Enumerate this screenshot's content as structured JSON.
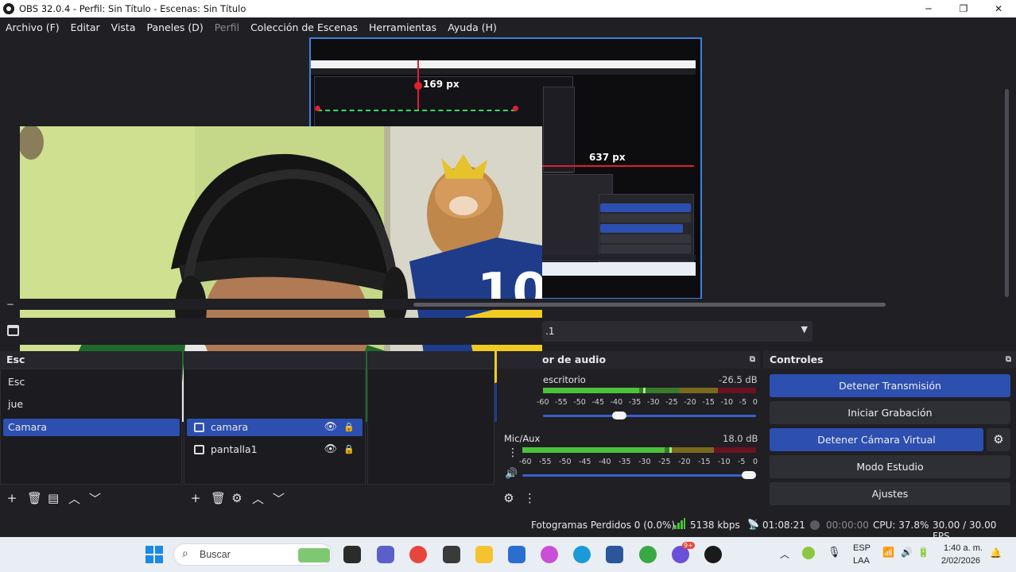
{
  "window": {
    "title": "OBS 32.0.4 - Perfil: Sin Título - Escenas: Sin Título",
    "minimize_glyph": "─",
    "maximize_glyph": "❐",
    "close_glyph": "✕"
  },
  "menu": [
    {
      "label": "Archivo (F)",
      "enabled": true
    },
    {
      "label": "Editar",
      "enabled": true
    },
    {
      "label": "Vista",
      "enabled": true
    },
    {
      "label": "Paneles (D)",
      "enabled": true
    },
    {
      "label": "Perfil",
      "enabled": false
    },
    {
      "label": "Colección de Escenas",
      "enabled": true
    },
    {
      "label": "Herramientas",
      "enabled": true
    },
    {
      "label": "Ayuda (H)",
      "enabled": true
    }
  ],
  "preview": {
    "label_top": "169 px",
    "label_right": "637 px"
  },
  "scene_bar": {
    "combo_value": ".1"
  },
  "scenes_dock": {
    "title": "Esc",
    "items": [
      "Esc",
      "jue",
      "Camara"
    ],
    "selected": "Camara"
  },
  "sources_dock": {
    "items": [
      {
        "name": "camara",
        "selected": true
      },
      {
        "name": "pantalla1",
        "selected": false
      }
    ]
  },
  "audio_dock": {
    "title": "or de audio",
    "tracks": [
      {
        "name": "escritorio",
        "db": "-26.5 dB",
        "level": 0.45,
        "peak": 0.47,
        "volume": 0.36
      },
      {
        "name": "Mic/Aux",
        "db": "18.0 dB",
        "level": 0.61,
        "peak": 0.63,
        "volume": 0.97
      }
    ],
    "ticks": [
      "-60",
      "-55",
      "-50",
      "-45",
      "-40",
      "-35",
      "-30",
      "-25",
      "-20",
      "-15",
      "-10",
      "-5",
      "0"
    ]
  },
  "controls_dock": {
    "title": "Controles",
    "buttons": [
      {
        "label": "Detener Transmisión",
        "active": true
      },
      {
        "label": "Iniciar Grabación",
        "active": false
      },
      {
        "label": "Detener Cámara Virtual",
        "active": true
      },
      {
        "label": "Modo Estudio",
        "active": false
      },
      {
        "label": "Ajustes",
        "active": false
      }
    ]
  },
  "status": {
    "dropped_frames": "Fotogramas Perdidos 0 (0.0%)",
    "bitrate": "5138 kbps",
    "stream_time": "01:08:21",
    "record_time": "00:00:00",
    "cpu": "CPU: 37.8%",
    "fps": "30.00 / 30.00 FPS"
  },
  "taskbar": {
    "search_placeholder": "Buscar",
    "lang_top": "ESP",
    "lang_bottom": "LAA",
    "time": "1:40 a. m.",
    "date": "2/02/2026",
    "badge": "9+"
  },
  "colors": {
    "accent_blue": "#2c4fb0",
    "preview_border": "#3f7fe0",
    "meter_green": "#3a7a2c",
    "meter_yellow": "#7a6a1e",
    "meter_red": "#6a1220"
  }
}
